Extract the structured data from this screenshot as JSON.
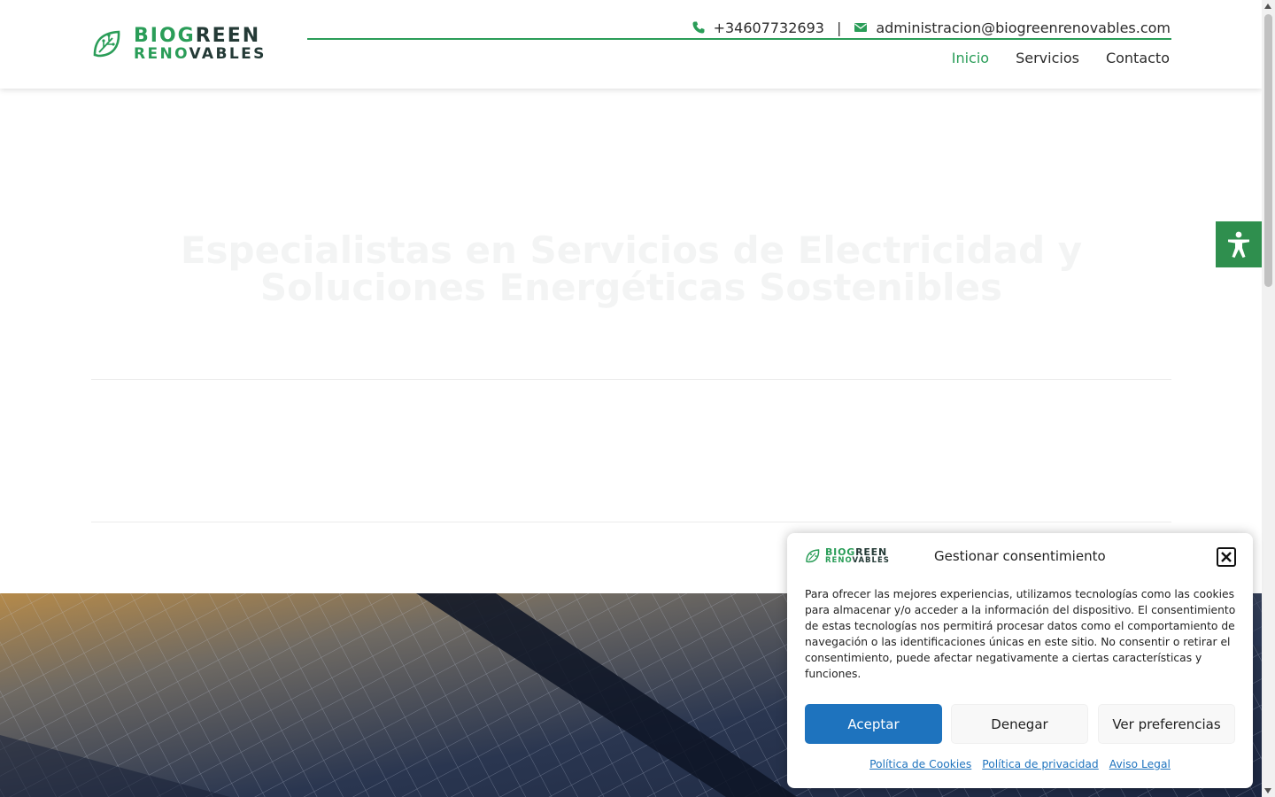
{
  "brand": {
    "name_line1_green": "BIOG",
    "name_line1_dark": "REEN",
    "name_line2_green": "RENO",
    "name_line2_dark": "VABLES",
    "green": "#2a9d58",
    "dark": "#243a36"
  },
  "topbar": {
    "phone": "+34607732693",
    "separator": "|",
    "email": "administracion@biogreenrenovables.com",
    "phone_icon": "phone-icon",
    "email_icon": "envelope-icon"
  },
  "nav": {
    "items": [
      {
        "label": "Inicio",
        "active": true
      },
      {
        "label": "Servicios",
        "active": false
      },
      {
        "label": "Contacto",
        "active": false
      }
    ]
  },
  "hero": {
    "title": "Especialistas en Servicios de Electricidad y Soluciones Energéticas Sostenibles"
  },
  "accessibility": {
    "icon": "accessibility-icon"
  },
  "cookie": {
    "title": "Gestionar consentimiento",
    "body": "Para ofrecer las mejores experiencias, utilizamos tecnologías como las cookies para almacenar y/o acceder a la información del dispositivo. El consentimiento de estas tecnologías nos permitirá procesar datos como el comportamiento de navegación o las identificaciones únicas en este sitio. No consentir o retirar el consentimiento, puede afectar negativamente a ciertas características y funciones.",
    "accept": "Aceptar",
    "deny": "Denegar",
    "prefs": "Ver preferencias",
    "links": [
      "Política de Cookies",
      "Política de privacidad",
      "Aviso Legal"
    ],
    "accent": "#1e73be"
  }
}
